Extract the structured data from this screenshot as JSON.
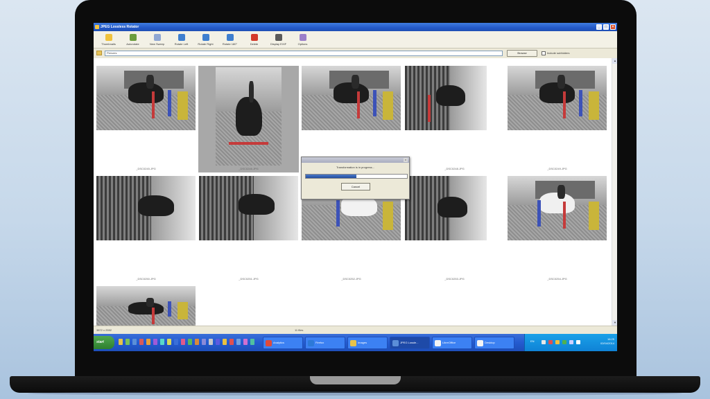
{
  "window": {
    "title": "JPEG Lossless Rotator"
  },
  "toolbar": [
    {
      "label": "Thumbnails",
      "color": "#f0c23c"
    },
    {
      "label": "Autorotate",
      "color": "#6b9d3c"
    },
    {
      "label": "New Sweep",
      "color": "#8fa7d3"
    },
    {
      "label": "Rotate Left",
      "color": "#3f7fcf"
    },
    {
      "label": "Rotate Right",
      "color": "#3f7fcf"
    },
    {
      "label": "Rotate 180°",
      "color": "#3f7fcf"
    },
    {
      "label": "Delete",
      "color": "#d43a2a"
    },
    {
      "label": "Display EXIF",
      "color": "#5a5a5a"
    },
    {
      "label": "Options",
      "color": "#9b7fc9"
    }
  ],
  "addressbar": {
    "path": "Pictures",
    "browse_label": "Browse",
    "include_subfolders_label": "Include subfolders"
  },
  "thumbnails": [
    {
      "name": "_DSC0245.JPG"
    },
    {
      "name": "_DSC0246.JPG"
    },
    {
      "name": "_DSC0247.JPG"
    },
    {
      "name": "_DSC0248.JPG"
    },
    {
      "name": "_DSC0249.JPG"
    },
    {
      "name": "_DSC0250.JPG"
    },
    {
      "name": "_DSC0251.JPG"
    },
    {
      "name": "_DSC0252.JPG"
    },
    {
      "name": "_DSC0253.JPG"
    },
    {
      "name": "_DSC0254.JPG"
    },
    {
      "name": "_DSC0255.JPG"
    }
  ],
  "dialog": {
    "message": "Transformation is in progress...",
    "progress": 0.5,
    "cancel_label": "Cancel"
  },
  "statusbar": {
    "left": "3872 x 2592",
    "center": "11 files"
  },
  "taskbar": {
    "start_label": "start",
    "tasks": [
      {
        "label": "Analytics",
        "color": "#e04a3a"
      },
      {
        "label": "Firefox",
        "color": "#2c79d8"
      },
      {
        "label": "Images",
        "color": "#e8c34a"
      },
      {
        "label": "JPEG Lossle...",
        "color": "#5b8ed8"
      },
      {
        "label": "LibreOffice",
        "color": "#f4f4f4"
      },
      {
        "label": "Desktop",
        "color": "#f4f4f4"
      }
    ],
    "clock_time": "16:25",
    "clock_date": "02/04/2014",
    "lang": "EN"
  }
}
